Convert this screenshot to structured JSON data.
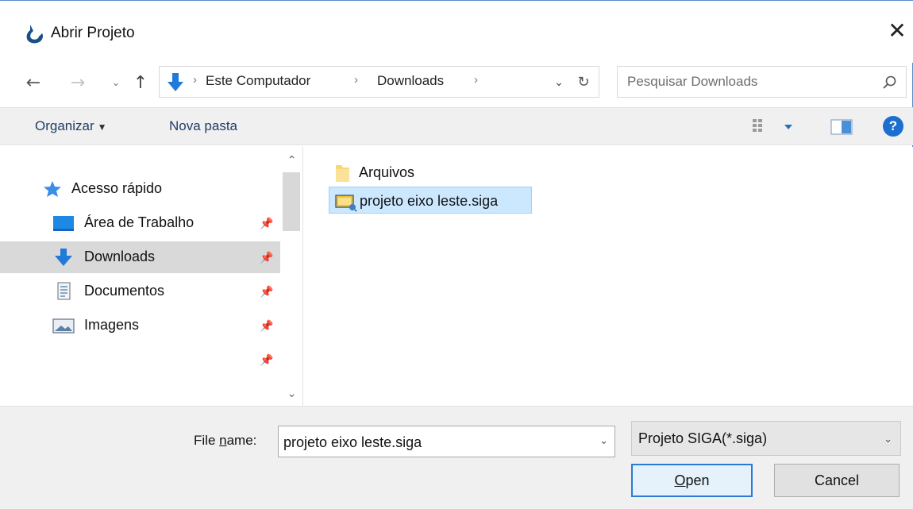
{
  "window": {
    "title": "Abrir Projeto",
    "close_glyph": "✕"
  },
  "navigation": {
    "back_glyph": "←",
    "forward_glyph": "→",
    "recent_glyph": "⌄",
    "up_glyph": "↑"
  },
  "address": {
    "breadcrumbs": [
      "Este Computador",
      "Downloads"
    ],
    "separator": "›",
    "dropdown_glyph": "⌄",
    "refresh_glyph": "↻"
  },
  "search": {
    "placeholder": "Pesquisar Downloads"
  },
  "toolbar": {
    "organize_label": "Organizar",
    "new_folder_label": "Nova pasta",
    "help_glyph": "?"
  },
  "sidebar": {
    "items": [
      {
        "label": "Acesso rápido",
        "icon": "star-icon",
        "pinned": false
      },
      {
        "label": "Área de Trabalho",
        "icon": "desktop-icon",
        "pinned": true
      },
      {
        "label": "Downloads",
        "icon": "download-arrow-icon",
        "pinned": true,
        "selected": true
      },
      {
        "label": "Documentos",
        "icon": "document-icon",
        "pinned": true
      },
      {
        "label": "Imagens",
        "icon": "pictures-icon",
        "pinned": true
      },
      {
        "label": "",
        "icon": "",
        "pinned": true
      }
    ]
  },
  "files": {
    "items": [
      {
        "name": "Arquivos",
        "icon": "folder-icon",
        "selected": false
      },
      {
        "name": "projeto eixo leste.siga",
        "icon": "siga-file-icon",
        "selected": true
      }
    ]
  },
  "footer": {
    "file_name_label_pre": "File ",
    "file_name_label_accel": "n",
    "file_name_label_post": "ame:",
    "file_name_value": "projeto eixo leste.siga",
    "file_type_value": "Projeto SIGA(*.siga)",
    "open_label_accel": "O",
    "open_label_rest": "pen",
    "cancel_label": "Cancel"
  },
  "colors": {
    "accent": "#1c6fcf",
    "selection": "#cce8ff",
    "selection_border": "#99d1ff",
    "folder": "#f8d775"
  }
}
